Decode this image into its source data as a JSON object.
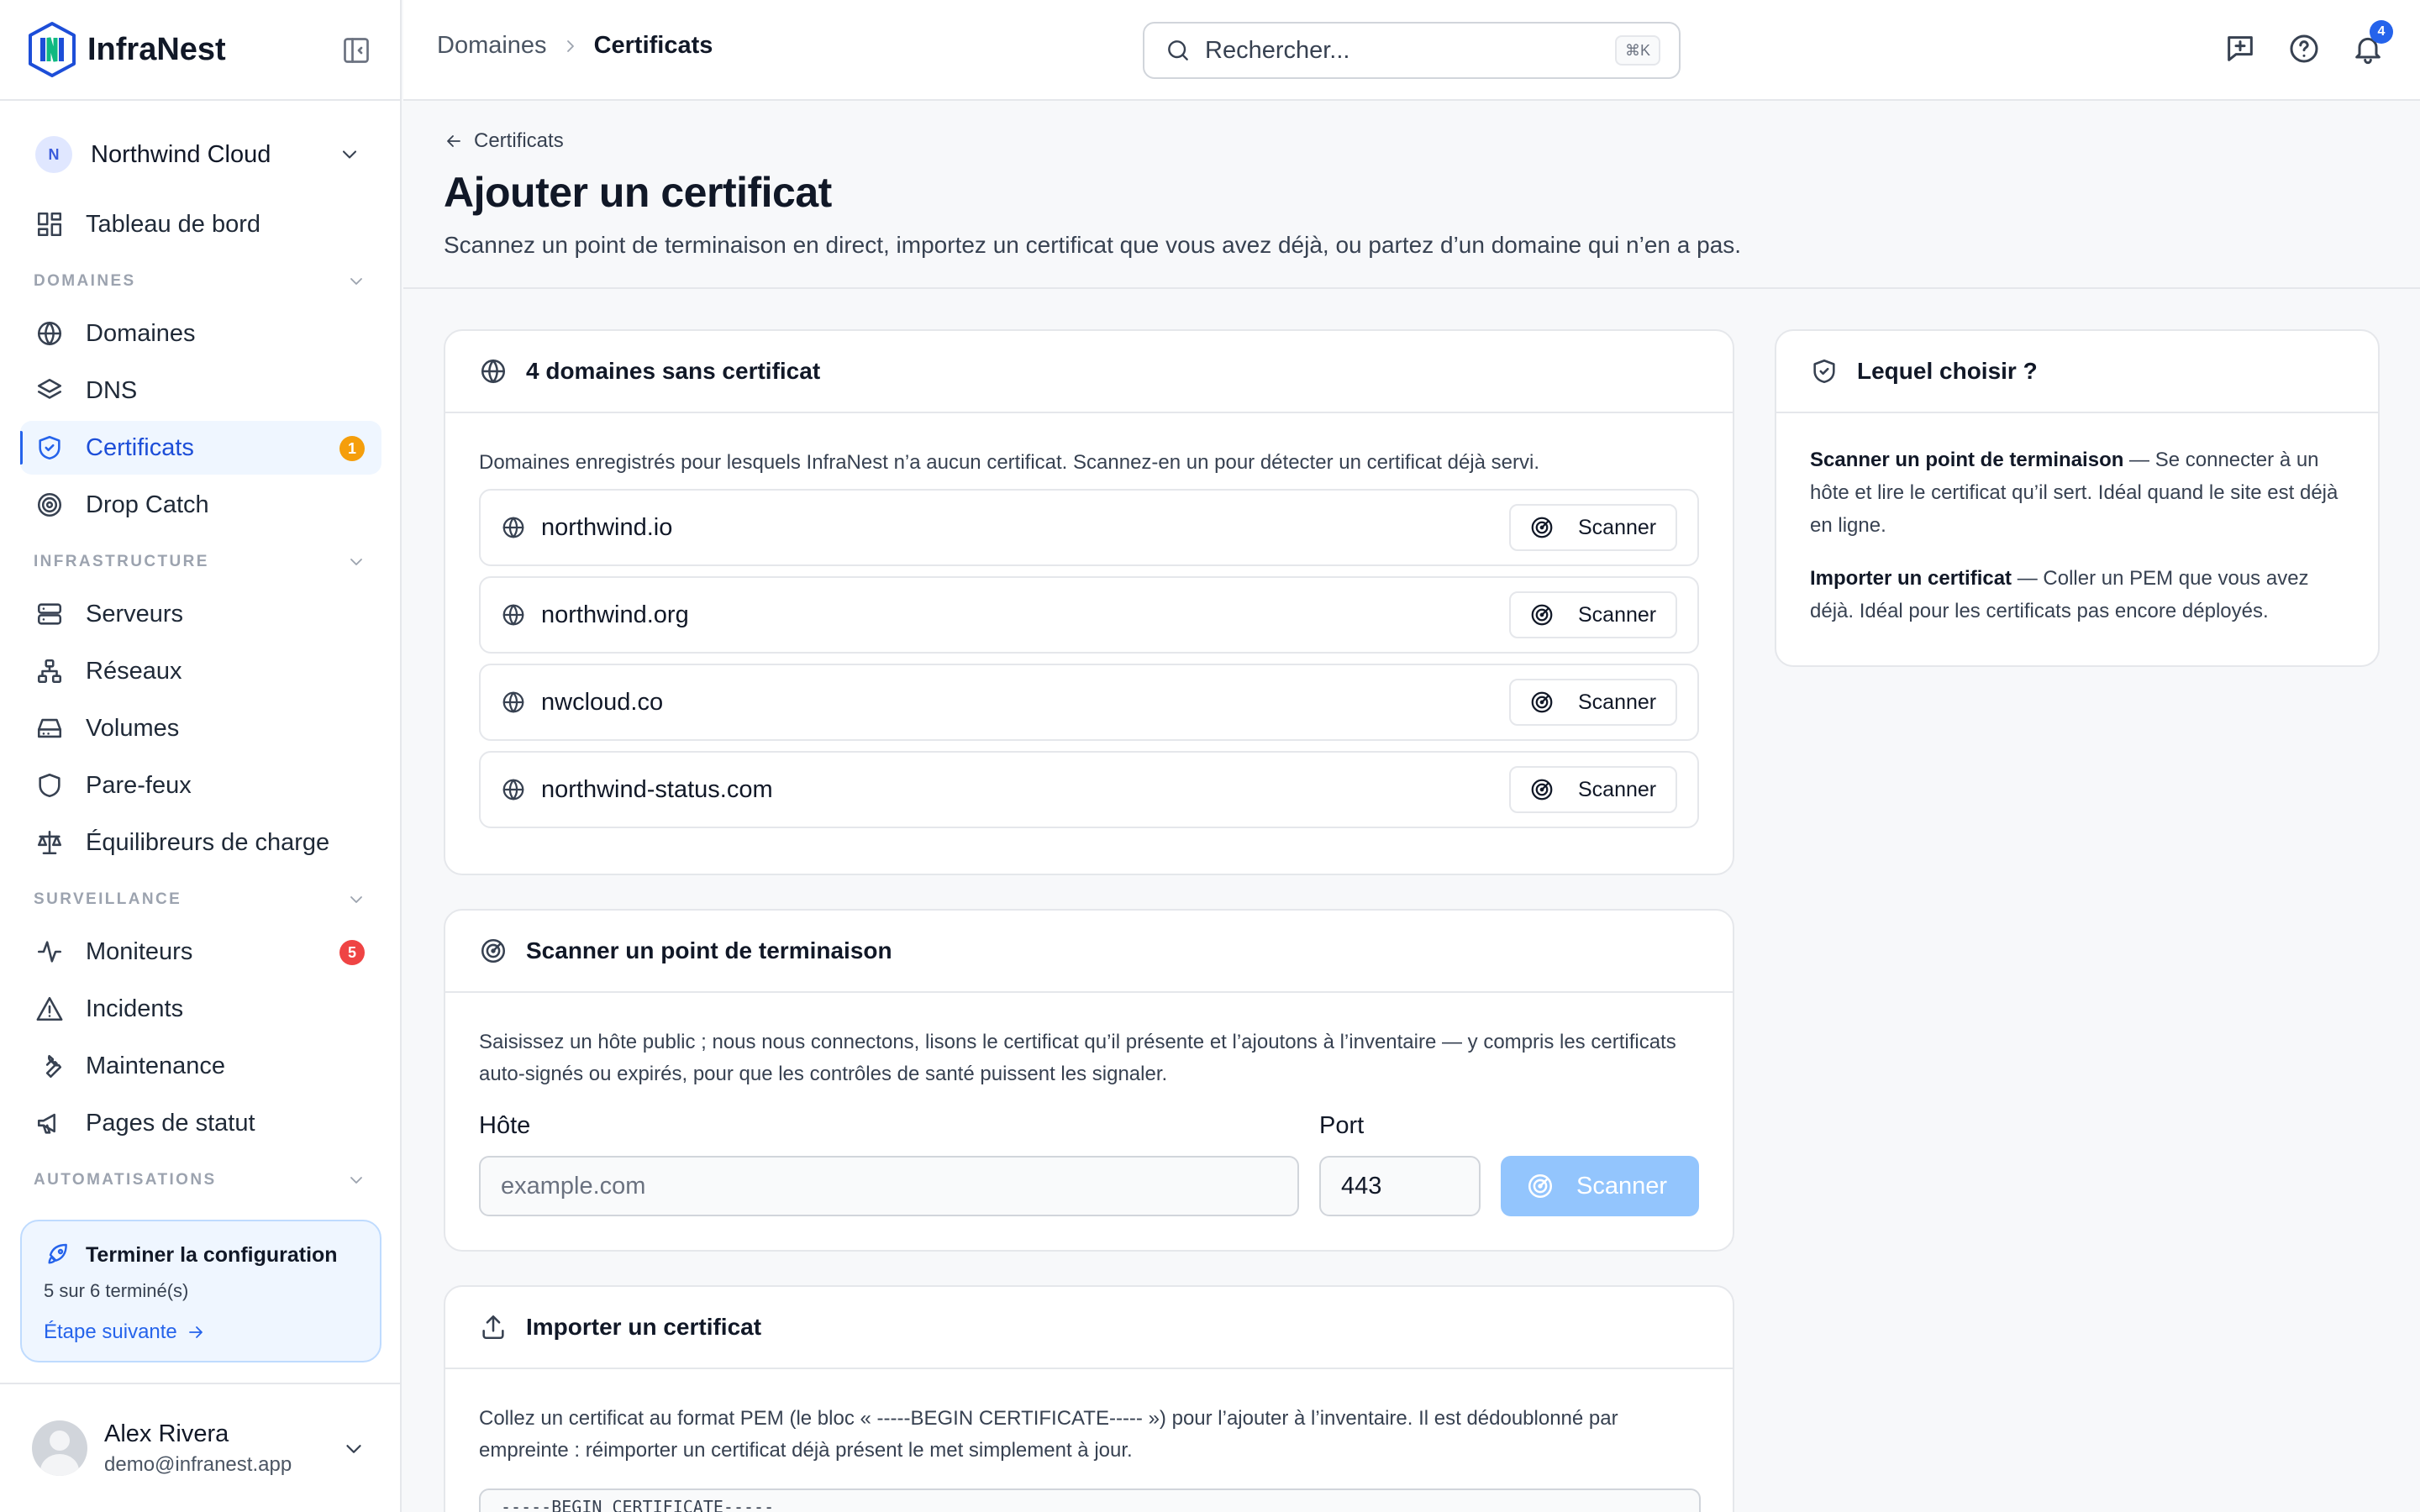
{
  "brand": {
    "name": "InfraNest"
  },
  "org": {
    "initial": "N",
    "name": "Northwind Cloud"
  },
  "nav": {
    "dashboard": "Tableau de bord",
    "sections": {
      "domains": "DOMAINES",
      "infrastructure": "INFRASTRUCTURE",
      "monitoring": "SURVEILLANCE",
      "automations": "AUTOMATISATIONS"
    },
    "domains": "Domaines",
    "dns": "DNS",
    "certificates": "Certificats",
    "certificates_badge": "1",
    "drop_catch": "Drop Catch",
    "servers": "Serveurs",
    "networks": "Réseaux",
    "volumes": "Volumes",
    "firewalls": "Pare-feux",
    "load_balancers": "Équilibreurs de charge",
    "monitors": "Moniteurs",
    "monitors_badge": "5",
    "incidents": "Incidents",
    "maintenance": "Maintenance",
    "status_pages": "Pages de statut"
  },
  "setup": {
    "title": "Terminer la configuration",
    "progress": "5 sur 6 terminé(s)",
    "next": "Étape suivante"
  },
  "user": {
    "name": "Alex Rivera",
    "email": "demo@infranest.app"
  },
  "topbar": {
    "breadcrumb_parent": "Domaines",
    "breadcrumb_current": "Certificats",
    "search_placeholder": "Rechercher...",
    "search_shortcut": "⌘K",
    "notifications_count": "4"
  },
  "header": {
    "back": "Certificats",
    "title": "Ajouter un certificat",
    "description": "Scannez un point de terminaison en direct, importez un certificat que vous avez déjà, ou partez d’un domaine qui n’en a pas."
  },
  "uncovered": {
    "title": "4 domaines sans certificat",
    "description": "Domaines enregistrés pour lesquels InfraNest n’a aucun certificat. Scannez-en un pour détecter un certificat déjà servi.",
    "scan_label": "Scanner",
    "domains": [
      "northwind.io",
      "northwind.org",
      "nwcloud.co",
      "northwind-status.com"
    ]
  },
  "scan": {
    "title": "Scanner un point de terminaison",
    "description": "Saisissez un hôte public ; nous nous connectons, lisons le certificat qu’il présente et l’ajoutons à l’inventaire — y compris les certificats auto-signés ou expirés, pour que les contrôles de santé puissent les signaler.",
    "host_label": "Hôte",
    "host_placeholder": "example.com",
    "port_label": "Port",
    "port_value": "443",
    "button": "Scanner"
  },
  "import": {
    "title": "Importer un certificat",
    "description": "Collez un certificat au format PEM (le bloc « -----BEGIN CERTIFICATE----- ») pour l’ajouter à l’inventaire. Il est dédoublonné par empreinte : réimporter un certificat déjà présent le met simplement à jour.",
    "pem_placeholder": "-----BEGIN CERTIFICATE-----"
  },
  "help": {
    "title": "Lequel choisir ?",
    "scan_term": "Scanner un point de terminaison",
    "scan_text": " — Se connecter à un hôte et lire le certificat qu’il sert. Idéal quand le site est déjà en ligne.",
    "import_term": "Importer un certificat",
    "import_text": " — Coller un PEM que vous avez déjà. Idéal pour les certificats pas encore déployés."
  },
  "colors": {
    "accent": "#2563eb",
    "accent_soft": "#eff6ff",
    "badge_orange": "#f59e0b",
    "badge_red": "#ef4444",
    "disabled_button": "#93c5fd"
  },
  "icons": [
    "logo-icon",
    "sidebar-collapse-icon",
    "chevron-down-icon",
    "dashboard-icon",
    "globe-icon",
    "layers-icon",
    "shield-check-icon",
    "target-icon",
    "server-icon",
    "network-icon",
    "volume-icon",
    "shield-icon",
    "scale-icon",
    "activity-icon",
    "alert-triangle-icon",
    "wrench-icon",
    "megaphone-icon",
    "rocket-icon",
    "arrow-right-icon",
    "arrow-left-icon",
    "search-icon",
    "feedback-icon",
    "help-icon",
    "bell-icon",
    "radar-icon",
    "upload-icon"
  ]
}
